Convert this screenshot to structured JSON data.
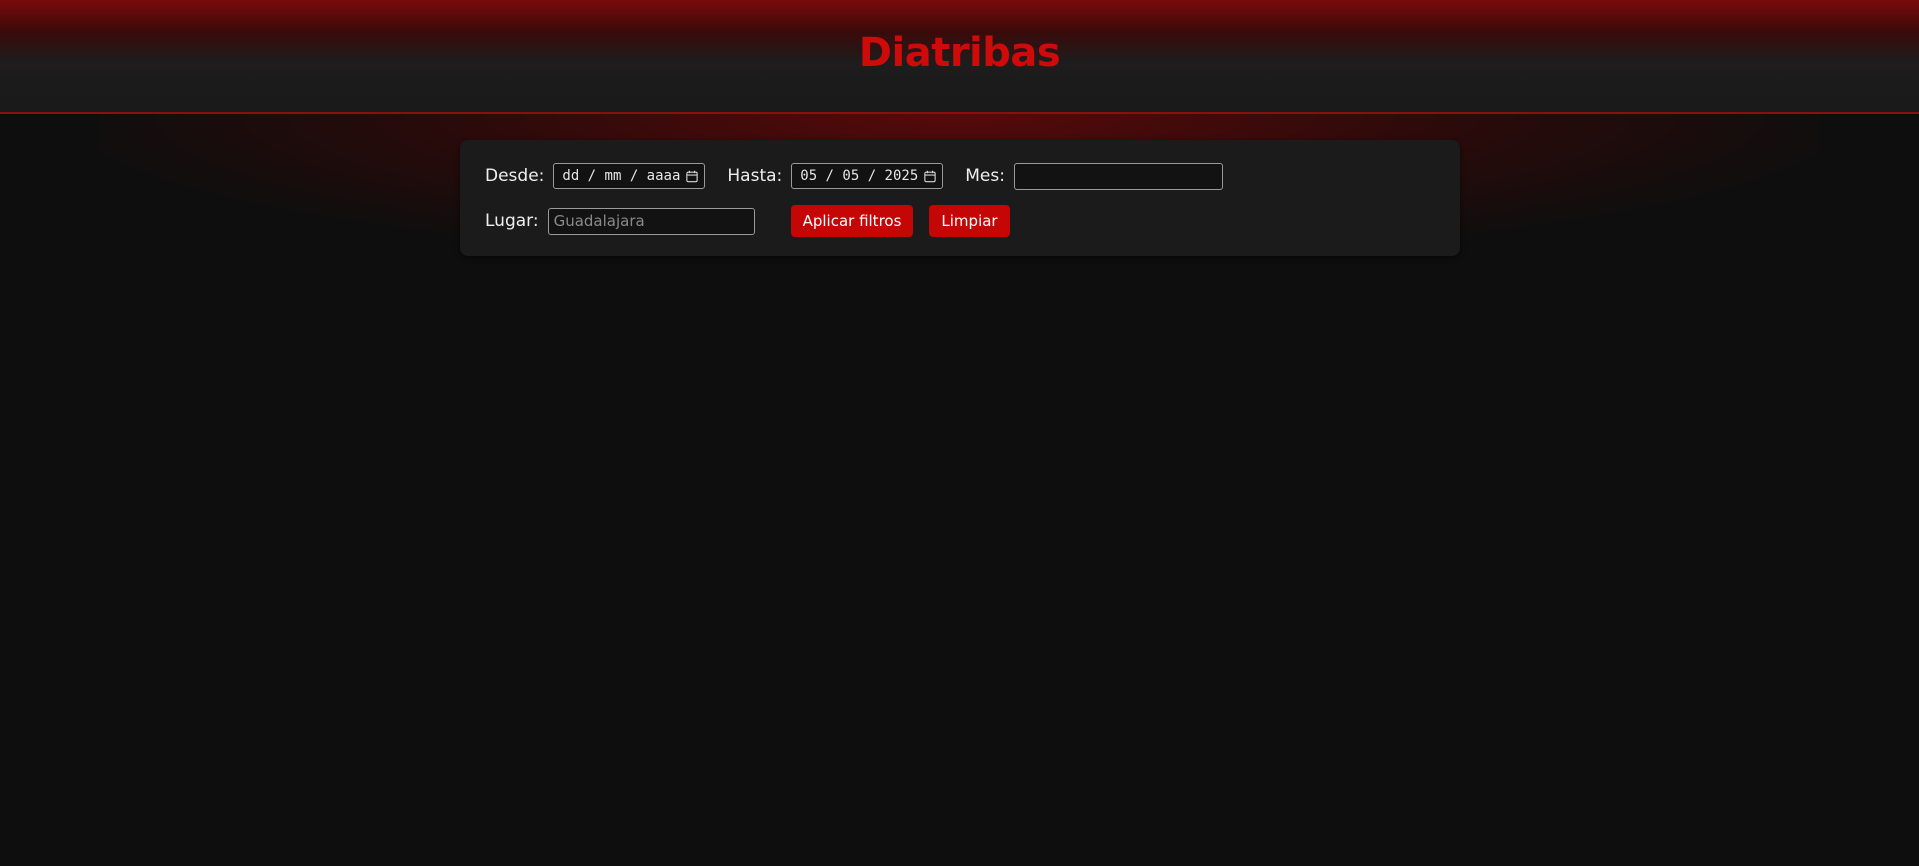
{
  "header": {
    "title": "Diatribas"
  },
  "filters": {
    "desde": {
      "label": "Desde:",
      "value": "dd / mm / aaaa"
    },
    "hasta": {
      "label": "Hasta:",
      "value": "05 / 05 / 2025"
    },
    "mes": {
      "label": "Mes:",
      "value": ""
    },
    "lugar": {
      "label": "Lugar:",
      "placeholder": "Guadalajara",
      "value": ""
    },
    "apply_label": "Aplicar filtros",
    "clear_label": "Limpiar"
  },
  "icons": {
    "calendar": "calendar-icon"
  },
  "colors": {
    "accent": "#c40606",
    "title": "#cf0a0a",
    "background": "#0e0e0e",
    "panel": "#1b1b1b"
  }
}
